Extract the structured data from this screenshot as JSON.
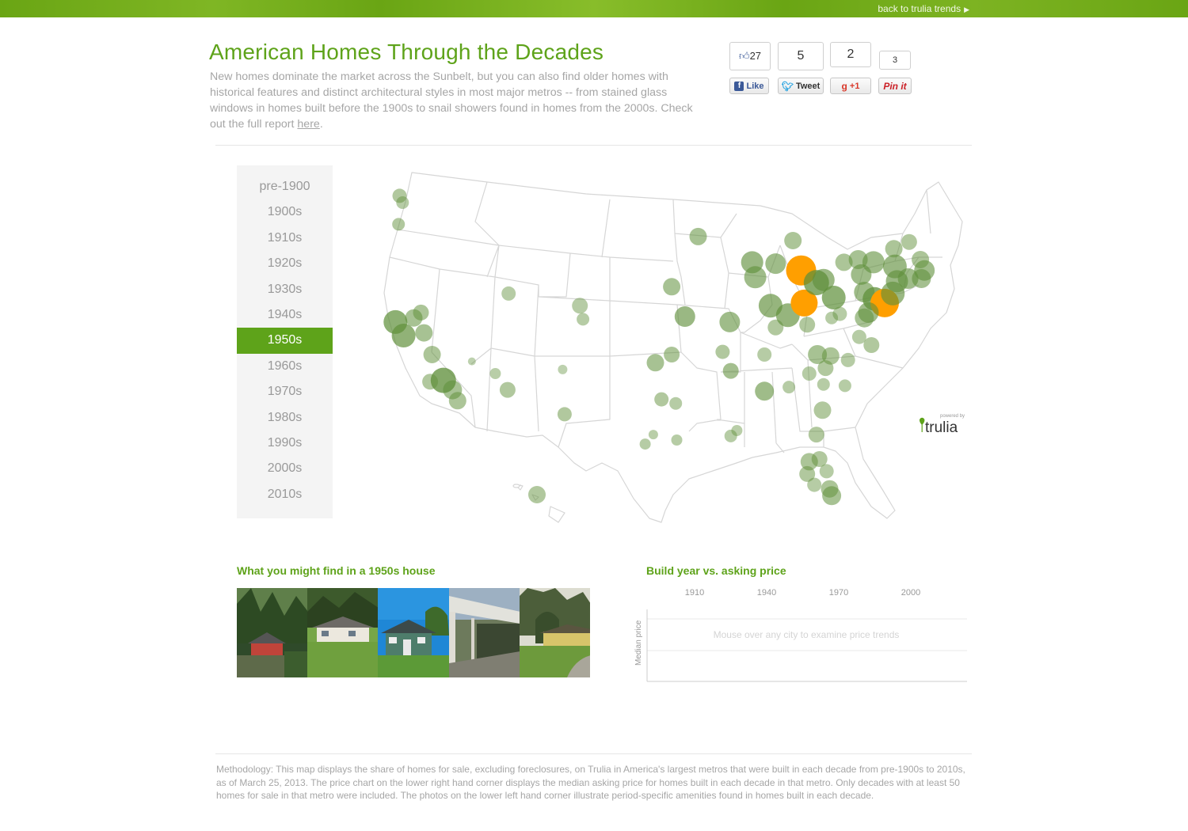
{
  "topbar": {
    "back_link": "back to trulia trends",
    "arrow": "▶"
  },
  "header": {
    "title": "American Homes Through the Decades",
    "intro": "New homes dominate the market across the Sunbelt, but you can also find older homes with historical features and distinct architectural styles in most major metros -- from stained glass windows in homes built before the 1900s to snail showers found in homes from the 2000s. Check out the full report ",
    "intro_link": "here",
    "intro_end": "."
  },
  "social": {
    "facebook": {
      "count": "27",
      "label": "Like",
      "icon": "f"
    },
    "twitter": {
      "count": "5",
      "label": "Tweet",
      "icon": "bird"
    },
    "gplus": {
      "count": "2",
      "label": "+1",
      "icon": "g"
    },
    "pinterest": {
      "count": "3",
      "label": "Pin it",
      "icon": "p"
    }
  },
  "decades": {
    "items": [
      "pre-1900",
      "1900s",
      "1910s",
      "1920s",
      "1930s",
      "1940s",
      "1950s",
      "1960s",
      "1970s",
      "1980s",
      "1990s",
      "2000s",
      "2010s"
    ],
    "selected": "1950s"
  },
  "map": {
    "logo_small": "powered by",
    "logo": "trulia",
    "colors": {
      "share": "#5f8f3a",
      "highlight": "#ff9f00",
      "state_line": "#dcdcdc",
      "land": "#ffffff"
    },
    "metros": [
      {
        "lon": -122.6,
        "lat": 47.9,
        "r": 9,
        "v": 0.35
      },
      {
        "lon": -122.3,
        "lat": 47.4,
        "r": 8,
        "v": 0.3
      },
      {
        "lon": -122.7,
        "lat": 45.8,
        "r": 8,
        "v": 0.35
      },
      {
        "lon": -123.0,
        "lat": 38.6,
        "r": 15,
        "v": 0.75
      },
      {
        "lon": -121.2,
        "lat": 38.9,
        "r": 11,
        "v": 0.45
      },
      {
        "lon": -122.2,
        "lat": 37.6,
        "r": 15,
        "v": 0.7
      },
      {
        "lon": -120.5,
        "lat": 39.3,
        "r": 10,
        "v": 0.4
      },
      {
        "lon": -120.2,
        "lat": 37.8,
        "r": 11,
        "v": 0.45
      },
      {
        "lon": -119.4,
        "lat": 36.2,
        "r": 11,
        "v": 0.4
      },
      {
        "lon": -118.3,
        "lat": 34.3,
        "r": 16,
        "v": 0.85
      },
      {
        "lon": -119.6,
        "lat": 34.2,
        "r": 10,
        "v": 0.35
      },
      {
        "lon": -117.4,
        "lat": 33.6,
        "r": 12,
        "v": 0.45
      },
      {
        "lon": -116.9,
        "lat": 32.8,
        "r": 11,
        "v": 0.4
      },
      {
        "lon": -115.5,
        "lat": 35.7,
        "r": 5,
        "v": 0.2
      },
      {
        "lon": -111.9,
        "lat": 40.7,
        "r": 9,
        "v": 0.3
      },
      {
        "lon": -112.0,
        "lat": 33.6,
        "r": 10,
        "v": 0.35
      },
      {
        "lon": -113.2,
        "lat": 34.8,
        "r": 7,
        "v": 0.25
      },
      {
        "lon": -104.9,
        "lat": 39.8,
        "r": 10,
        "v": 0.3
      },
      {
        "lon": -104.6,
        "lat": 38.8,
        "r": 8,
        "v": 0.3
      },
      {
        "lon": -106.6,
        "lat": 35.1,
        "r": 6,
        "v": 0.2
      },
      {
        "lon": -106.4,
        "lat": 31.8,
        "r": 9,
        "v": 0.35
      },
      {
        "lon": -95.9,
        "lat": 41.2,
        "r": 11,
        "v": 0.45
      },
      {
        "lon": -94.6,
        "lat": 39.0,
        "r": 13,
        "v": 0.6
      },
      {
        "lon": -97.5,
        "lat": 35.6,
        "r": 11,
        "v": 0.45
      },
      {
        "lon": -95.9,
        "lat": 36.2,
        "r": 10,
        "v": 0.4
      },
      {
        "lon": -96.9,
        "lat": 32.9,
        "r": 9,
        "v": 0.35
      },
      {
        "lon": -95.5,
        "lat": 32.6,
        "r": 8,
        "v": 0.3
      },
      {
        "lon": -98.5,
        "lat": 29.6,
        "r": 7,
        "v": 0.3
      },
      {
        "lon": -95.4,
        "lat": 29.9,
        "r": 7,
        "v": 0.3
      },
      {
        "lon": -97.7,
        "lat": 30.3,
        "r": 6,
        "v": 0.25
      },
      {
        "lon": -93.3,
        "lat": 44.9,
        "r": 11,
        "v": 0.45
      },
      {
        "lon": -90.9,
        "lat": 36.4,
        "r": 9,
        "v": 0.35
      },
      {
        "lon": -90.2,
        "lat": 38.6,
        "r": 13,
        "v": 0.55
      },
      {
        "lon": -90.1,
        "lat": 35.0,
        "r": 10,
        "v": 0.5
      },
      {
        "lon": -90.1,
        "lat": 30.2,
        "r": 8,
        "v": 0.3
      },
      {
        "lon": -89.5,
        "lat": 30.6,
        "r": 7,
        "v": 0.25
      },
      {
        "lon": -88.0,
        "lat": 43.0,
        "r": 14,
        "v": 0.6
      },
      {
        "lon": -87.7,
        "lat": 41.9,
        "r": 14,
        "v": 0.55
      },
      {
        "lon": -86.8,
        "lat": 36.2,
        "r": 9,
        "v": 0.3
      },
      {
        "lon": -86.8,
        "lat": 33.5,
        "r": 12,
        "v": 0.55
      },
      {
        "lon": -84.4,
        "lat": 33.8,
        "r": 8,
        "v": 0.3
      },
      {
        "lon": -85.7,
        "lat": 38.2,
        "r": 10,
        "v": 0.35
      },
      {
        "lon": -84.5,
        "lat": 39.1,
        "r": 15,
        "v": 0.65
      },
      {
        "lon": -86.2,
        "lat": 39.8,
        "r": 15,
        "v": 0.65
      },
      {
        "lon": -85.7,
        "lat": 42.9,
        "r": 13,
        "v": 0.55
      },
      {
        "lon": -84.0,
        "lat": 44.6,
        "r": 11,
        "v": 0.4
      },
      {
        "lon": -83.2,
        "lat": 42.4,
        "r": 19,
        "v": 1.0,
        "hl": true
      },
      {
        "lon": -82.9,
        "lat": 40.0,
        "r": 17,
        "v": 1.0,
        "hl": true
      },
      {
        "lon": -81.7,
        "lat": 41.5,
        "r": 16,
        "v": 0.8
      },
      {
        "lon": -80.0,
        "lat": 40.4,
        "r": 15,
        "v": 0.75
      },
      {
        "lon": -81.0,
        "lat": 41.7,
        "r": 14,
        "v": 0.6
      },
      {
        "lon": -82.6,
        "lat": 38.4,
        "r": 10,
        "v": 0.35
      },
      {
        "lon": -81.6,
        "lat": 36.2,
        "r": 12,
        "v": 0.45
      },
      {
        "lon": -80.3,
        "lat": 36.1,
        "r": 11,
        "v": 0.4
      },
      {
        "lon": -80.8,
        "lat": 35.2,
        "r": 10,
        "v": 0.35
      },
      {
        "lon": -82.4,
        "lat": 34.8,
        "r": 9,
        "v": 0.3
      },
      {
        "lon": -81.0,
        "lat": 34.0,
        "r": 8,
        "v": 0.3
      },
      {
        "lon": -79.0,
        "lat": 43.0,
        "r": 11,
        "v": 0.4
      },
      {
        "lon": -77.6,
        "lat": 43.2,
        "r": 12,
        "v": 0.45
      },
      {
        "lon": -76.1,
        "lat": 43.0,
        "r": 14,
        "v": 0.55
      },
      {
        "lon": -74.0,
        "lat": 42.7,
        "r": 15,
        "v": 0.6
      },
      {
        "lon": -73.8,
        "lat": 41.6,
        "r": 14,
        "v": 0.6
      },
      {
        "lon": -77.3,
        "lat": 42.1,
        "r": 13,
        "v": 0.55
      },
      {
        "lon": -76.0,
        "lat": 40.3,
        "r": 15,
        "v": 0.8
      },
      {
        "lon": -77.0,
        "lat": 40.8,
        "r": 13,
        "v": 0.55
      },
      {
        "lon": -75.0,
        "lat": 40.0,
        "r": 18,
        "v": 1.0,
        "hl": true
      },
      {
        "lon": -74.2,
        "lat": 40.7,
        "r": 15,
        "v": 0.6
      },
      {
        "lon": -72.7,
        "lat": 41.8,
        "r": 13,
        "v": 0.55
      },
      {
        "lon": -71.4,
        "lat": 41.8,
        "r": 12,
        "v": 0.5
      },
      {
        "lon": -71.1,
        "lat": 42.4,
        "r": 13,
        "v": 0.55
      },
      {
        "lon": -72.6,
        "lat": 44.5,
        "r": 10,
        "v": 0.35
      },
      {
        "lon": -71.5,
        "lat": 43.2,
        "r": 11,
        "v": 0.4
      },
      {
        "lon": -74.1,
        "lat": 44.0,
        "r": 11,
        "v": 0.4
      },
      {
        "lon": -76.6,
        "lat": 39.3,
        "r": 13,
        "v": 0.55
      },
      {
        "lon": -77.0,
        "lat": 38.9,
        "r": 12,
        "v": 0.45
      },
      {
        "lon": -76.3,
        "lat": 36.9,
        "r": 10,
        "v": 0.35
      },
      {
        "lon": -77.5,
        "lat": 37.5,
        "r": 9,
        "v": 0.3
      },
      {
        "lon": -78.6,
        "lat": 35.8,
        "r": 9,
        "v": 0.3
      },
      {
        "lon": -79.4,
        "lat": 39.2,
        "r": 9,
        "v": 0.3
      },
      {
        "lon": -80.2,
        "lat": 38.9,
        "r": 8,
        "v": 0.3
      },
      {
        "lon": -78.9,
        "lat": 33.9,
        "r": 8,
        "v": 0.3
      },
      {
        "lon": -81.1,
        "lat": 32.1,
        "r": 11,
        "v": 0.35
      },
      {
        "lon": -81.7,
        "lat": 30.3,
        "r": 10,
        "v": 0.35
      },
      {
        "lon": -82.4,
        "lat": 28.3,
        "r": 11,
        "v": 0.4
      },
      {
        "lon": -81.4,
        "lat": 28.5,
        "r": 10,
        "v": 0.35
      },
      {
        "lon": -82.6,
        "lat": 27.4,
        "r": 10,
        "v": 0.35
      },
      {
        "lon": -80.7,
        "lat": 27.6,
        "r": 9,
        "v": 0.3
      },
      {
        "lon": -81.9,
        "lat": 26.6,
        "r": 9,
        "v": 0.3
      },
      {
        "lon": -80.2,
        "lat": 25.8,
        "r": 12,
        "v": 0.45
      },
      {
        "lon": -80.4,
        "lat": 26.3,
        "r": 11,
        "v": 0.4
      },
      {
        "lon": -157.9,
        "lat": 21.4,
        "r": 11,
        "v": 0.35
      }
    ]
  },
  "photos_section": {
    "title": "What you might find in a 1950s house",
    "photos": [
      "house-1950s-red-ranch",
      "house-1950s-white-ranch",
      "house-1950s-green-cottage",
      "house-1950s-carport",
      "house-1950s-yellow-ranch"
    ]
  },
  "price_chart": {
    "title": "Build year vs. asking price",
    "chart_data": {
      "type": "line",
      "x": [],
      "series": [],
      "x_tick_labels": [
        "1910",
        "1940",
        "1970",
        "2000"
      ],
      "ylabel": "Median price",
      "placeholder": "Mouse over any city to examine price trends"
    }
  },
  "methodology": "Methodology: This map displays the share of homes for sale, excluding foreclosures, on Trulia in America's largest metros that were built in each decade from pre-1900s to 2010s, as of March 25, 2013. The price chart on the lower right hand corner displays the median asking price for homes built in each decade in that metro. Only decades with at least 50 homes for sale in that metro were included. The photos on the lower left hand corner illustrate period-specific amenities found in homes built in each decade."
}
